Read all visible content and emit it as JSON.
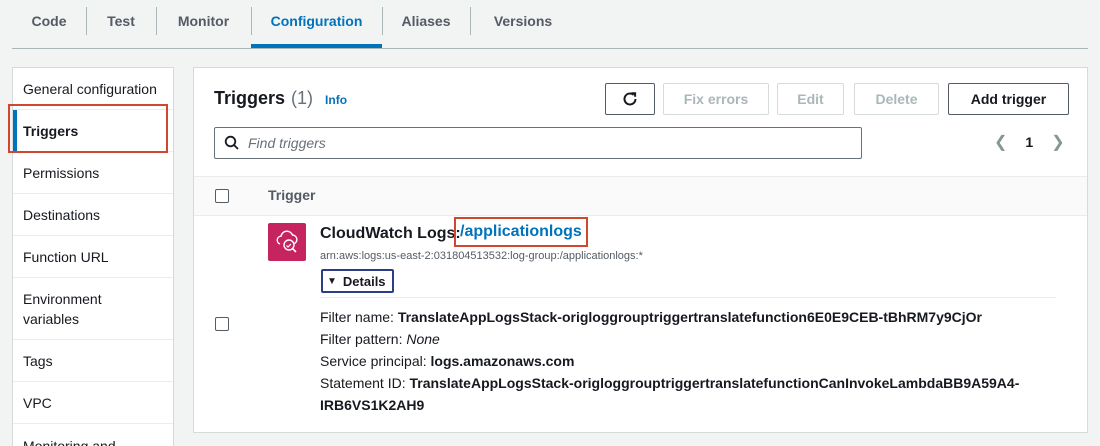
{
  "tabs": [
    "Code",
    "Test",
    "Monitor",
    "Configuration",
    "Aliases",
    "Versions"
  ],
  "active_tab": "Configuration",
  "nav": {
    "items": [
      "General configuration",
      "Triggers",
      "Permissions",
      "Destinations",
      "Function URL",
      "Environment variables",
      "Tags",
      "VPC",
      "Monitoring and"
    ],
    "active": "Triggers"
  },
  "panel": {
    "title": "Triggers",
    "count": "(1)",
    "info_link": "Info",
    "buttons": {
      "refresh_icon": "refresh-icon",
      "fix_errors": "Fix errors",
      "edit": "Edit",
      "delete": "Delete",
      "add_trigger": "Add trigger"
    },
    "search_placeholder": "Find triggers",
    "pager": {
      "page": "1"
    },
    "column_header": "Trigger"
  },
  "trigger": {
    "service": "CloudWatch Logs:",
    "log_group_link": "/applicationlogs",
    "arn": "arn:aws:logs:us-east-2:031804513532:log-group:/applicationlogs:*",
    "details_label": "Details",
    "fields": {
      "filter_name_label": "Filter name:",
      "filter_name_value": "TranslateAppLogsStack-origloggrouptriggertranslatefunction6E0E9CEB-tBhRM7y9CjOr",
      "filter_pattern_label": "Filter pattern:",
      "filter_pattern_value": "None",
      "service_principal_label": "Service principal:",
      "service_principal_value": "logs.amazonaws.com",
      "statement_id_label": "Statement ID:",
      "statement_id_value_line1": "TranslateAppLogsStack-origloggrouptriggertranslatefunctionCanInvokeLambdaBB9A59A4-",
      "statement_id_value_line2": "IRB6VS1K2AH9"
    }
  },
  "colors": {
    "accent": "#0073bb",
    "highlight": "#d0462f",
    "cloudwatch": "#c6245e"
  }
}
